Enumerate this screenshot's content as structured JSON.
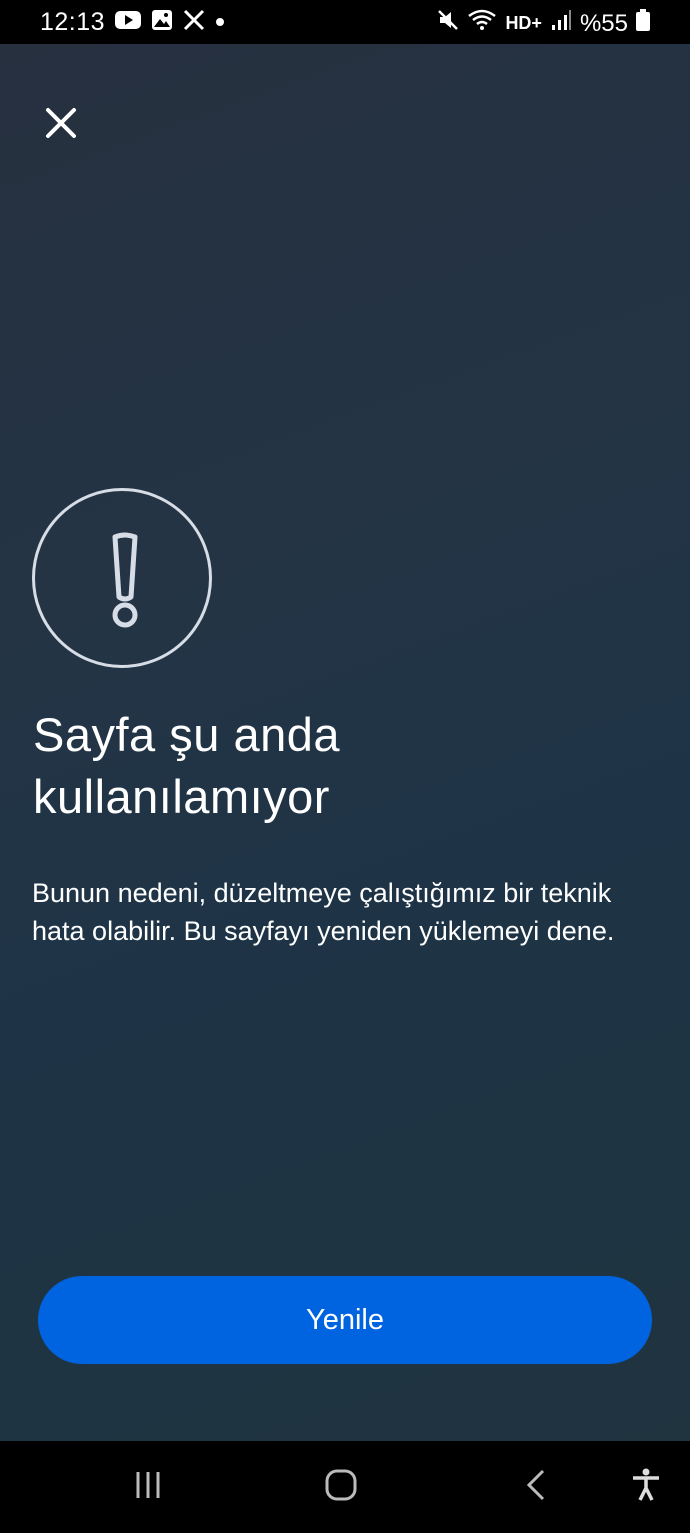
{
  "status_bar": {
    "time": "12:13",
    "battery": "%55",
    "network": "HD+",
    "left_icons": [
      "youtube-icon",
      "gallery-icon",
      "x-icon",
      "dot-icon"
    ],
    "right_icons": [
      "mute-icon",
      "wifi-icon",
      "signal-icon",
      "battery-icon"
    ]
  },
  "error_page": {
    "title": "Sayfa şu anda kullanılamıyor",
    "description": "Bunun nedeni, düzeltmeye çalıştığımız bir teknik hata olabilir. Bu sayfayı yeniden yüklemeyi dene.",
    "refresh_label": "Yenile",
    "icon": "warning-circle-icon",
    "close_icon": "close-icon"
  },
  "nav_bar": {
    "icons": [
      "recents-icon",
      "home-icon",
      "back-icon",
      "accessibility-icon"
    ]
  },
  "colors": {
    "accent": "#0064e0",
    "background": "#243445",
    "text": "#ffffff"
  }
}
